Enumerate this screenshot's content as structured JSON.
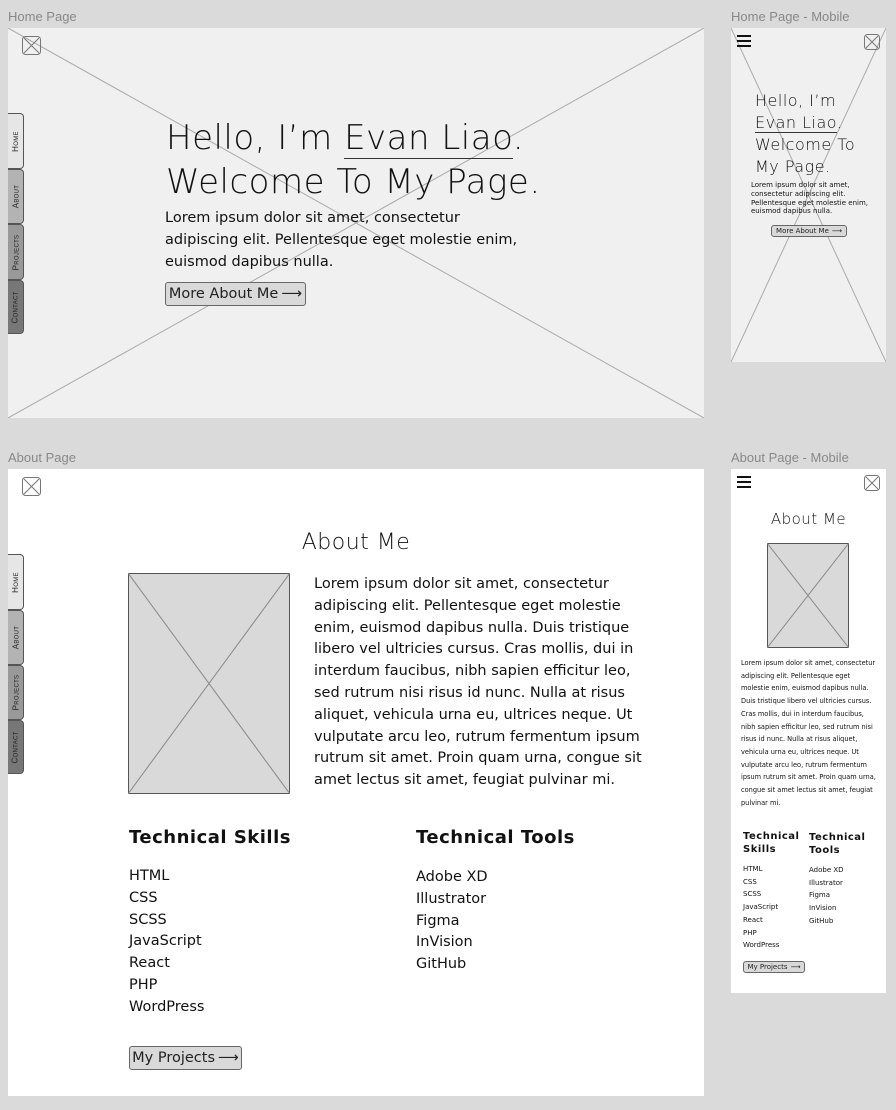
{
  "artboards": {
    "home": "Home Page",
    "home_mobile": "Home Page - Mobile",
    "about": "About Page",
    "about_mobile": "About Page - Mobile"
  },
  "nav_tabs": [
    "Home",
    "About",
    "Projects",
    "Contact"
  ],
  "hero": {
    "line1_prefix": "Hello, I’m ",
    "name": "Evan Liao",
    "line1_suffix": ".",
    "line2": "Welcome To My Page.",
    "mobile_line1": "Hello, I’m",
    "mobile_line3": "Welcome To",
    "mobile_line4": "My Page.",
    "paragraph": "Lorem ipsum dolor sit amet, consectetur adipiscing elit. Pellentesque eget molestie enim, euismod dapibus nulla.",
    "button": "More About Me",
    "arrow": "⟶"
  },
  "about": {
    "title": "About Me",
    "paragraph": "Lorem ipsum dolor sit amet, consectetur adipiscing elit. Pellentesque eget molestie enim, euismod dapibus nulla. Duis tristique libero vel ultricies cursus. Cras mollis, dui in interdum faucibus, nibh sapien efficitur leo, sed rutrum nisi risus id nunc. Nulla at risus aliquet, vehicula urna eu, ultrices neque. Ut vulputate arcu leo, rutrum fermentum ipsum rutrum sit amet. Proin quam urna, congue sit amet lectus sit amet, feugiat pulvinar mi.",
    "skills_title": "Technical Skills",
    "skills_title_1": "Technical",
    "skills_title_2": "Skills",
    "skills": [
      "HTML",
      "CSS",
      "SCSS",
      "JavaScript",
      "React",
      "PHP",
      "WordPress"
    ],
    "tools_title": "Technical Tools",
    "tools_title_1": "Technical",
    "tools_title_2": "Tools",
    "tools": [
      "Adobe XD",
      "Illustrator",
      "Figma",
      "InVision",
      "GitHub"
    ],
    "button": "My Projects",
    "arrow": "⟶"
  },
  "colors": {
    "canvas": "#dadada",
    "home_bg": "#f0f0f0",
    "about_bg": "#ffffff",
    "placeholder": "#d9d9d9",
    "tab_home": "#e6e6e6",
    "tab_about": "#b3b3b3",
    "tab_projects": "#999999",
    "tab_contact": "#777777"
  }
}
